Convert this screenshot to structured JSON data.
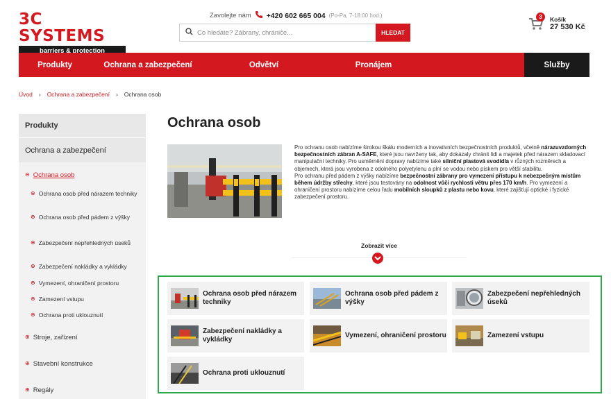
{
  "header": {
    "logo_title": "3C SYSTEMS",
    "logo_sub": "barriers & protection",
    "call_label": "Zavolejte nám",
    "phone": "+420 602 665 004",
    "hours": "(Po-Pa, 7-18:00 hod.)",
    "search_placeholder": "Co hledáte? Zábrany, chrániče...",
    "search_button": "HLEDAT",
    "cart_count": "3",
    "cart_label": "Košík",
    "cart_total": "27 530 Kč"
  },
  "nav": [
    {
      "label": "Produkty"
    },
    {
      "label": "Ochrana a zabezpečení"
    },
    {
      "label": "Odvětví"
    },
    {
      "label": "Pronájem"
    },
    {
      "label": "Služby"
    }
  ],
  "breadcrumb": {
    "home": "Úvod",
    "sep": "›",
    "parent": "Ochrana a zabezpečení",
    "current": "Ochrana osob"
  },
  "sidebar": {
    "top": "Produkty",
    "section": "Ochrana a zabezpečení",
    "active": "Ochrana osob",
    "subitems": [
      "Ochrana osob před nárazem techniky",
      "Ochrana osob před pádem z výšky",
      "Zabezpečení nepřehledných úseků",
      "Zabezpečení nakládky a vykládky",
      "Vymezení, ohraničení prostoru",
      "Zamezení vstupu",
      "Ochrana proti uklouznutí"
    ],
    "main_items": [
      "Stroje, zařízení",
      "Stavební konstrukce",
      "Regály"
    ]
  },
  "main": {
    "title": "Ochrana osob",
    "desc": {
      "p1a": "Pro ochranu osob nabízíme širokou škálu moderních a inovativních bezpečnostních produktů, včetně ",
      "p1b": "nárazuvzdorných bezpečnostních zábran A-SAFE",
      "p1c": ", které jsou navrženy tak, aby dokázaly chránit lidi a majetek před nárazem skladovací manipulační techniky. Pro usměrnění dopravy nabízíme také ",
      "p1d": "silniční plastová svodidla",
      "p1e": " v různých rozměrech a objemech, která jsou vyrobena z odolného polyetylenu a plní se vodou nebo pískem pro větší stabilitu.",
      "p2a": "Pro ochranu před pádem z výšky nabízíme ",
      "p2b": "bezpečnostní zábrany pro vymezení přístupu k nebezpečným místům během údržby střechy",
      "p2c": ", které jsou testovány na ",
      "p2d": "odolnost vůči rychlosti větru přes 170 km/h",
      "p2e": ". Pro vymezení a ohraničení prostoru nabízíme celou řadu ",
      "p2f": "mobilních sloupků z plastu nebo kovu",
      "p2g": ", které zajišťují optické i fyzické zabezpečení prostoru."
    },
    "more_label": "Zobrazit více",
    "cards": [
      {
        "title": "Ochrana osob před nárazem techniky"
      },
      {
        "title": "Ochrana osob před pádem z výšky"
      },
      {
        "title": "Zabezpečení nepřehledných úseků"
      },
      {
        "title": "Zabezpečení nakládky a vykládky"
      },
      {
        "title": "Vymezení, ohraničení prostoru"
      },
      {
        "title": "Zamezení vstupu"
      },
      {
        "title": "Ochrana proti uklouznutí"
      }
    ]
  },
  "colors": {
    "brand_red": "#d4181f",
    "dark": "#1a1a1a",
    "highlight_green": "#2ea84a"
  }
}
